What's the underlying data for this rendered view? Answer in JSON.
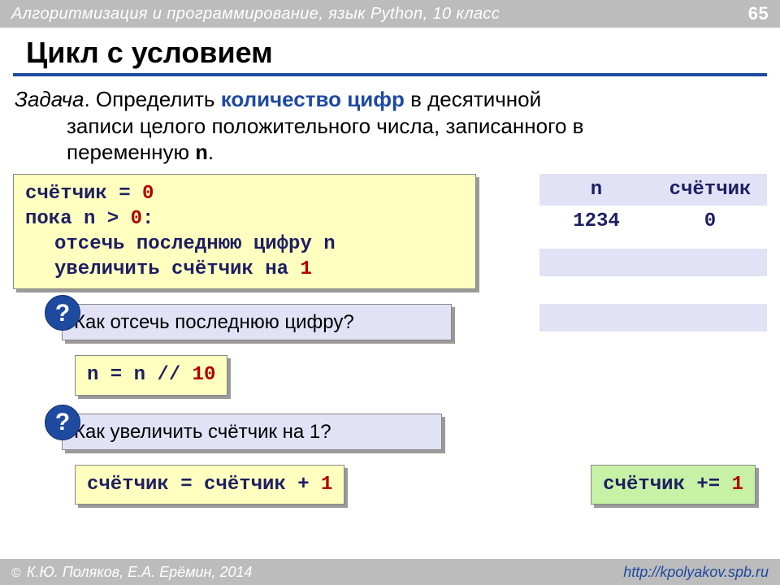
{
  "header": {
    "course": "Алгоритмизация и программирование, язык Python, 10 класс",
    "page": "65"
  },
  "title": "Цикл с условием",
  "task": {
    "label": "Задача",
    "line1_before": ". Определить ",
    "keyword": "количество цифр",
    "line1_after": " в десятичной",
    "line2": "записи целого положительного числа, записанного в",
    "line3_before": "переменную ",
    "var": "n",
    "line3_after": "."
  },
  "pseudo": {
    "l1a": "счётчик = ",
    "l1b": "0",
    "l2a": "пока n > ",
    "l2b": "0",
    "l2c": ":",
    "l3": "отсечь последнюю цифру n",
    "l4a": "увеличить счётчик на ",
    "l4b": "1"
  },
  "trace": {
    "h1": "n",
    "h2": "счётчик",
    "r1c1": "1234",
    "r1c2": "0"
  },
  "q1": {
    "text": " Как отсечь последнюю цифру?",
    "mark": "?"
  },
  "code1": {
    "a": "n = n // ",
    "b": "10"
  },
  "q2": {
    "text": " Как увеличить счётчик на 1?",
    "mark": "?"
  },
  "code2": {
    "a": "счётчик = счётчик + ",
    "b": "1"
  },
  "code3": {
    "a": "счётчик += ",
    "b": "1"
  },
  "footer": {
    "copymark": "©",
    "authors": " К.Ю. Поляков, Е.А. Ерёмин, 2014",
    "url": "http://kpolyakov.spb.ru"
  }
}
